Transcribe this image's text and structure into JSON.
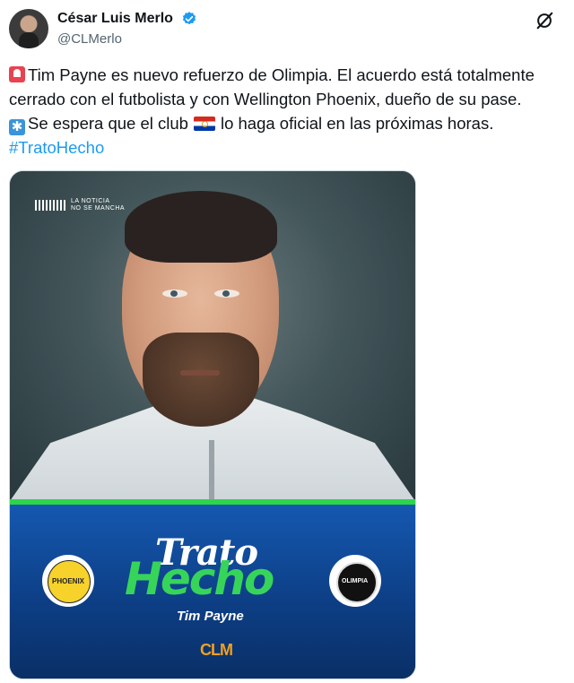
{
  "author": {
    "name": "César Luis Merlo",
    "handle": "@CLMerlo"
  },
  "tweet": {
    "line1": "Tim Payne es nuevo refuerzo de Olimpia. El acuerdo está totalmente cerrado con el futbolista y con Wellington Phoenix, dueño de su pase.",
    "line2_before_flag": "Se espera que el club",
    "line2_after_flag": "lo haga oficial en las próximas horas.",
    "hashtag": "#TratoHecho"
  },
  "image": {
    "photo_logo_line1": "LA NOTICIA",
    "photo_logo_line2": "NO SE MANCHA",
    "banner_word1": "Trato",
    "banner_word2": "Hecho",
    "player_name": "Tim Payne",
    "brand_mark": "CLM",
    "left_badge": "Wellington Phoenix",
    "right_badge": "Olimpia"
  },
  "icons": {
    "verified": "verified-badge-icon",
    "grok": "grok-icon",
    "siren": "siren-emoji",
    "sparkle": "sparkle-emoji",
    "flag": "paraguay-flag-emoji"
  },
  "colors": {
    "link": "#1d9bf0",
    "text": "#0f1419",
    "muted": "#536471",
    "accent_green": "#2bd64a"
  }
}
